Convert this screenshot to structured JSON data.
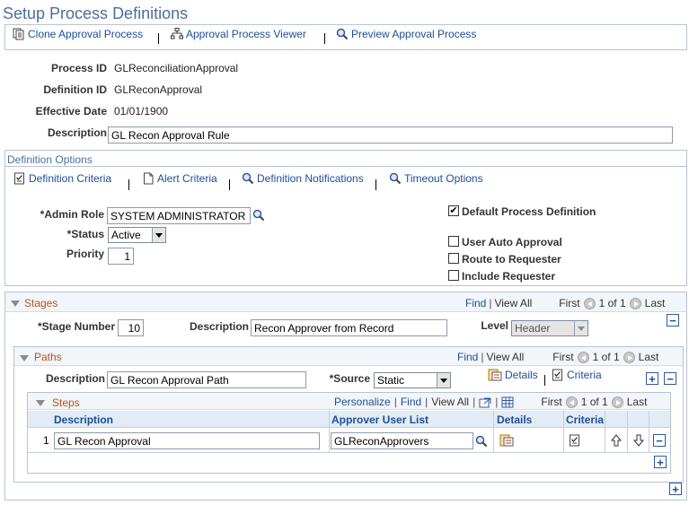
{
  "page": {
    "title": "Setup Process Definitions"
  },
  "toolbar": {
    "clone": "Clone Approval Process",
    "viewer": "Approval Process Viewer",
    "preview": "Preview Approval Process"
  },
  "header": {
    "process_id_label": "Process ID",
    "process_id": "GLReconciliationApproval",
    "definition_id_label": "Definition ID",
    "definition_id": "GLReconApproval",
    "effective_date_label": "Effective Date",
    "effective_date": "01/01/1900",
    "description_label": "Description",
    "description": "GL Recon Approval Rule"
  },
  "options": {
    "title": "Definition Options",
    "links": {
      "criteria": "Definition Criteria",
      "alert": "Alert Criteria",
      "notifications": "Definition Notifications",
      "timeout": "Timeout Options"
    },
    "admin_role_label": "*Admin Role",
    "admin_role": "SYSTEM ADMINISTRATOR",
    "status_label": "*Status",
    "status": "Active",
    "priority_label": "Priority",
    "priority": "1",
    "default_label": "Default Process Definition",
    "default_checked": true,
    "auto_label": "User Auto Approval",
    "route_label": "Route to Requester",
    "include_label": "Include Requester"
  },
  "stages": {
    "title": "Stages",
    "find": "Find",
    "view_all": "View All",
    "first": "First",
    "pager": "1 of 1",
    "last": "Last",
    "stage_number_label": "*Stage Number",
    "stage_number": "10",
    "description_label": "Description",
    "description": "Recon Approver from Record",
    "level_label": "Level",
    "level": "Header"
  },
  "paths": {
    "title": "Paths",
    "find": "Find",
    "view_all": "View All",
    "first": "First",
    "pager": "1 of 1",
    "last": "Last",
    "description_label": "Description",
    "description": "GL Recon Approval Path",
    "source_label": "*Source",
    "source": "Static",
    "details": "Details",
    "criteria": "Criteria"
  },
  "steps": {
    "title": "Steps",
    "personalize": "Personalize",
    "find": "Find",
    "view_all": "View All",
    "first": "First",
    "pager": "1 of 1",
    "last": "Last",
    "columns": {
      "description": "Description",
      "approver": "Approver User List",
      "details": "Details",
      "criteria": "Criteria"
    },
    "rows": [
      {
        "num": "1",
        "description": "GL Recon Approval",
        "approver": "GLReconApprovers"
      }
    ]
  },
  "colors": {
    "link": "#1c4f96",
    "section": "#4a6f9a",
    "section_orange": "#b8541a",
    "border": "#b8c3d1",
    "grid_header_bg": "#e3ebf5"
  }
}
